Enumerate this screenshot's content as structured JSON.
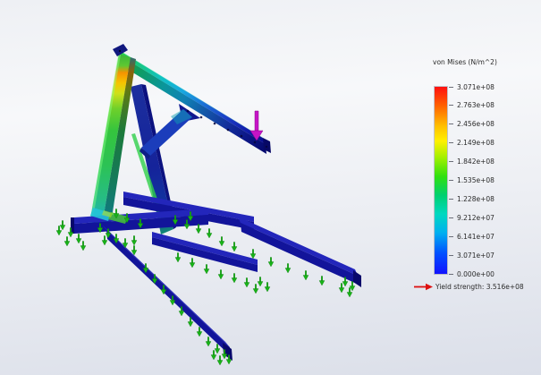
{
  "legend": {
    "title": "von Mises (N/m^2)",
    "tick_values": [
      "3.071e+08",
      "2.763e+08",
      "2.456e+08",
      "2.149e+08",
      "1.842e+08",
      "1.535e+08",
      "1.228e+08",
      "9.212e+07",
      "6.141e+07",
      "3.071e+07",
      "0.000e+00"
    ],
    "yield_note": "Yield strength: 3.516e+08"
  },
  "icons": {
    "yield_arrow": "right-arrow",
    "load_arrow": "down-arrow",
    "fixture": "up-stem-down-arrow-restraint"
  },
  "colors": {
    "text": "#2a2a2a",
    "yield_arrow": "#dd1111",
    "load_arrow": "#c614c6",
    "load_arrow_dark": "#8a088a",
    "fixture_green": "#17b217",
    "fixture_green_dark": "#0c6e0c",
    "beam_navy": "#12149a",
    "beam_navy_top": "#2326bb",
    "beam_navy_dark": "#08086b",
    "legend_gradient": [
      "#ff1010 0%",
      "#ff6000 10%",
      "#ffc000 21%",
      "#fff000 29%",
      "#a0f000 38%",
      "#30e010 48%",
      "#00d070 58%",
      "#00d8c0 68%",
      "#00b0f0 78%",
      "#0050ff 89%",
      "#1212ff 100%"
    ]
  }
}
